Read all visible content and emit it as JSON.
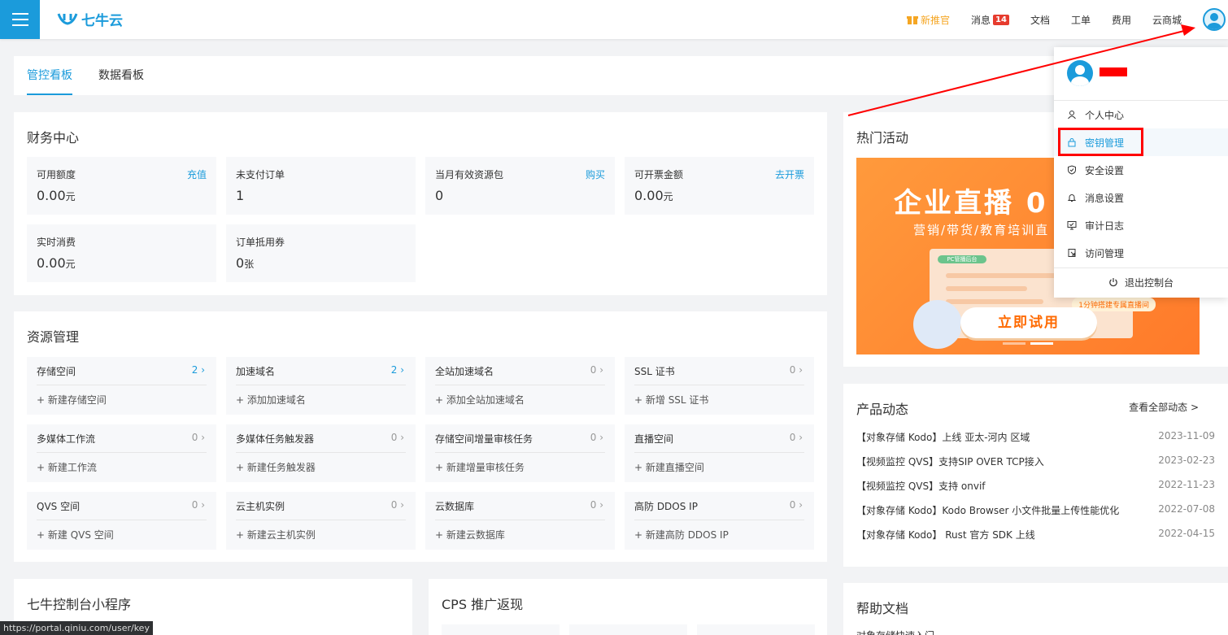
{
  "header": {
    "logo_text": "七牛云",
    "nav": {
      "new_user": "新推官",
      "messages": "消息",
      "messages_count": "14",
      "docs": "文档",
      "tickets": "工单",
      "billing": "费用",
      "marketplace": "云商城"
    }
  },
  "tabs": [
    "管控看板",
    "数据看板"
  ],
  "finance": {
    "title": "财务中心",
    "tiles": [
      {
        "label": "可用额度",
        "action": "充值",
        "value": "0.00",
        "unit": "元"
      },
      {
        "label": "未支付订单",
        "action": "",
        "value": "1",
        "unit": ""
      },
      {
        "label": "当月有效资源包",
        "action": "购买",
        "value": "0",
        "unit": ""
      },
      {
        "label": "可开票金额",
        "action": "去开票",
        "value": "0.00",
        "unit": "元"
      },
      {
        "label": "实时消费",
        "action": "",
        "value": "0.00",
        "unit": "元"
      },
      {
        "label": "订单抵用券",
        "action": "",
        "value": "0",
        "unit": "张"
      }
    ]
  },
  "resources": {
    "title": "资源管理",
    "tiles": [
      {
        "label": "存储空间",
        "count": "2",
        "add": "新建存储空间"
      },
      {
        "label": "加速域名",
        "count": "2",
        "add": "添加加速域名"
      },
      {
        "label": "全站加速域名",
        "count": "0",
        "add": "添加全站加速域名"
      },
      {
        "label": "SSL 证书",
        "count": "0",
        "add": "新增 SSL 证书"
      },
      {
        "label": "多媒体工作流",
        "count": "0",
        "add": "新建工作流"
      },
      {
        "label": "多媒体任务触发器",
        "count": "0",
        "add": "新建任务触发器"
      },
      {
        "label": "存储空间增量审核任务",
        "count": "0",
        "add": "新建增量审核任务"
      },
      {
        "label": "直播空间",
        "count": "0",
        "add": "新建直播空间"
      },
      {
        "label": "QVS 空间",
        "count": "0",
        "add": "新建 QVS 空间"
      },
      {
        "label": "云主机实例",
        "count": "0",
        "add": "新建云主机实例"
      },
      {
        "label": "云数据库",
        "count": "0",
        "add": "新建云数据库"
      },
      {
        "label": "高防 DDOS IP",
        "count": "0",
        "add": "新建高防 DDOS IP"
      }
    ]
  },
  "mini_program": {
    "title": "七牛控制台小程序"
  },
  "cps": {
    "title": "CPS 推广返现"
  },
  "hot": {
    "title": "热门活动",
    "banner_title": "企业直播 0",
    "banner_sub": "营销/带货/教育培训直",
    "banner_tag": "1分钟搭建专属直播间",
    "banner_button": "立即试用",
    "banner_chip": "PC管播后台"
  },
  "news": {
    "title": "产品动态",
    "view_all": "查看全部动态 >",
    "items": [
      {
        "text": "【对象存储 Kodo】上线 亚太-河内 区域",
        "date": "2023-11-09"
      },
      {
        "text": "【视频监控 QVS】支持SIP OVER TCP接入",
        "date": "2023-02-23"
      },
      {
        "text": "【视频监控 QVS】支持 onvif",
        "date": "2022-11-23"
      },
      {
        "text": "【对象存储 Kodo】Kodo Browser 小文件批量上传性能优化",
        "date": "2022-07-08"
      },
      {
        "text": "【对象存储 Kodo】 Rust 官方 SDK 上线",
        "date": "2022-04-15"
      }
    ]
  },
  "help": {
    "title": "帮助文档",
    "first_item": "对象存储快速入门"
  },
  "dropdown": {
    "items": [
      {
        "label": "个人中心",
        "icon": "user-icon"
      },
      {
        "label": "密钥管理",
        "icon": "lock-icon"
      },
      {
        "label": "安全设置",
        "icon": "shield-icon"
      },
      {
        "label": "消息设置",
        "icon": "bell-icon"
      },
      {
        "label": "审计日志",
        "icon": "monitor-icon"
      },
      {
        "label": "访问管理",
        "icon": "access-icon"
      }
    ],
    "logout": "退出控制台"
  },
  "status_url": "https://portal.qiniu.com/user/key",
  "colors": {
    "accent": "#1b9bdb",
    "highlight": "#ff0000",
    "gift": "#f5a623"
  }
}
